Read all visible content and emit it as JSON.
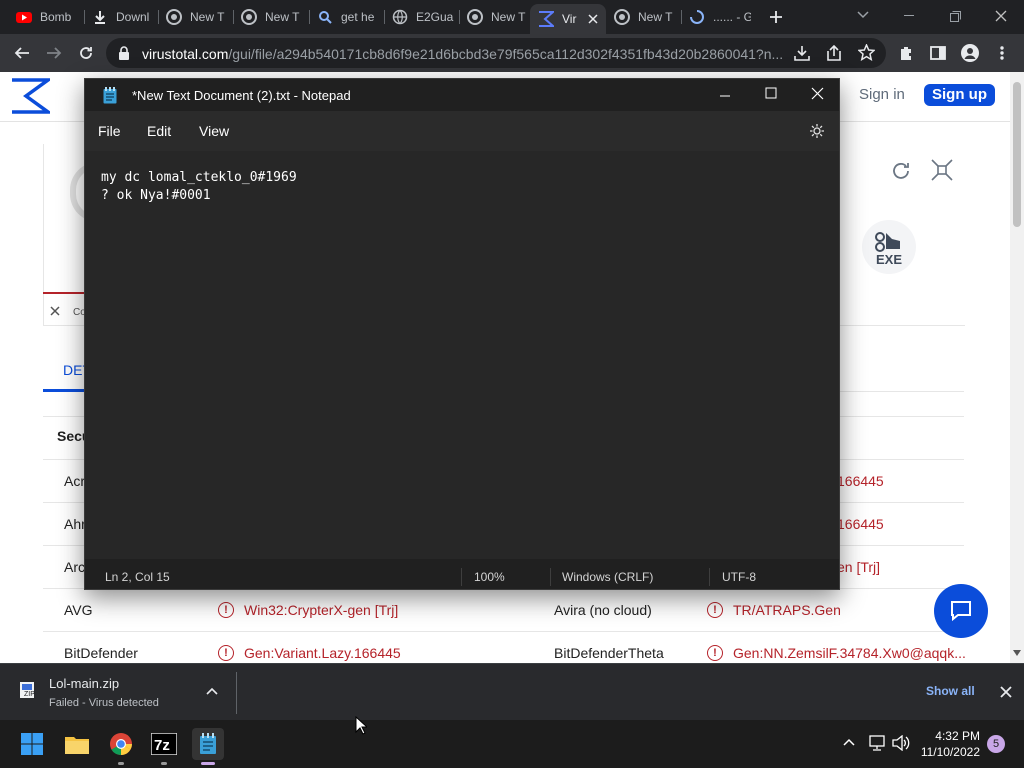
{
  "browser": {
    "tabs": [
      {
        "label": "Bomb",
        "icon": "youtube-icon"
      },
      {
        "label": "Downl",
        "icon": "download-icon"
      },
      {
        "label": "New T",
        "icon": "chrome-icon"
      },
      {
        "label": "New T",
        "icon": "chrome-icon"
      },
      {
        "label": "get he",
        "icon": "search-icon"
      },
      {
        "label": "E2Gua",
        "icon": "globe-icon"
      },
      {
        "label": "New T",
        "icon": "chrome-icon"
      },
      {
        "label": "Vir",
        "icon": "virustotal-icon",
        "active": true
      },
      {
        "label": "New T",
        "icon": "chrome-icon"
      },
      {
        "label": "...... - G",
        "icon": "loading-icon"
      }
    ],
    "url_host": "virustotal.com",
    "url_rest": "/gui/file/a294b540171cb8d6f9e21d6bcbd3e79f565ca112d302f4351fb43d20b2860041?n..."
  },
  "virustotal": {
    "sign_in": "Sign in",
    "sign_up": "Sign up",
    "exe_label": "EXE",
    "tab_partial": "DET",
    "close_partial": "Co",
    "section_partial": "Secu",
    "rows": [
      {
        "engine": "Acr",
        "engine2": "",
        "result2": "166445"
      },
      {
        "engine": "Ahr",
        "engine2": "",
        "result2": "166445"
      },
      {
        "engine": "Arc",
        "engine2": "",
        "result2": "en [Trj]"
      },
      {
        "engine": "AVG",
        "result": "Win32:CrypterX-gen [Trj]",
        "engine2": "Avira (no cloud)",
        "result2": "TR/ATRAPS.Gen"
      },
      {
        "engine": "BitDefender",
        "result": "Gen:Variant.Lazy.166445",
        "engine2": "BitDefenderTheta",
        "result2": "Gen:NN.ZemsilF.34784.Xw0@aqqk..."
      }
    ]
  },
  "notepad": {
    "title": "*New Text Document (2).txt - Notepad",
    "menu": [
      "File",
      "Edit",
      "View"
    ],
    "lines": [
      "my dc lomal_cteklo_0#1969",
      "? ok Nya!#0001"
    ],
    "status": {
      "position": "Ln 2, Col 15",
      "zoom": "100%",
      "line_ending": "Windows (CRLF)",
      "encoding": "UTF-8"
    }
  },
  "download": {
    "filename": "Lol-main.zip",
    "status": "Failed - Virus detected",
    "show_all": "Show all"
  },
  "taskbar": {
    "time": "4:32 PM",
    "date": "11/10/2022",
    "notifications": "5",
    "apps": [
      "start-icon",
      "file-explorer-icon",
      "chrome-icon",
      "7zip-icon",
      "notepad-icon"
    ]
  },
  "colors": {
    "accent": "#0b4dda",
    "detection_red": "#b5232a",
    "notepad_bg": "#272727"
  }
}
